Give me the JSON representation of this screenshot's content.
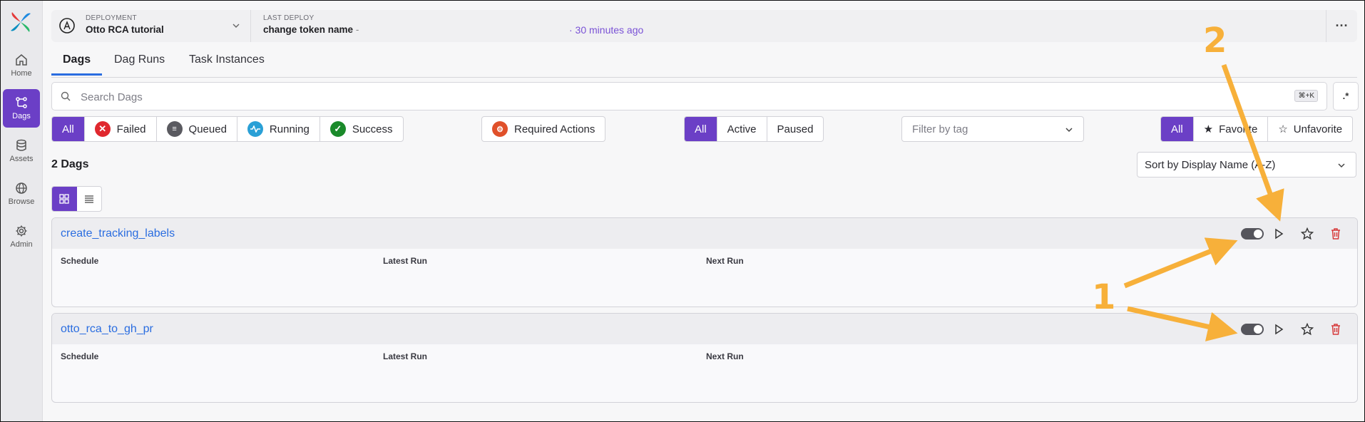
{
  "sidebar": {
    "items": [
      {
        "label": "Home",
        "icon": "home-icon"
      },
      {
        "label": "Dags",
        "icon": "dag-icon",
        "active": true
      },
      {
        "label": "Assets",
        "icon": "database-icon"
      },
      {
        "label": "Browse",
        "icon": "globe-icon"
      },
      {
        "label": "Admin",
        "icon": "gear-icon"
      }
    ]
  },
  "header": {
    "deployment_label": "DEPLOYMENT",
    "deployment_name": "Otto RCA tutorial",
    "last_deploy_label": "LAST DEPLOY",
    "last_deploy_name": "change token name",
    "last_deploy_sep": "-",
    "last_deploy_ago": "· 30 minutes ago",
    "more_label": "···"
  },
  "tabs": [
    {
      "label": "Dags",
      "active": true
    },
    {
      "label": "Dag Runs"
    },
    {
      "label": "Task Instances"
    }
  ],
  "search": {
    "placeholder": "Search Dags",
    "shortcut": "⌘+K",
    "advanced_label": ".*"
  },
  "state_filters": {
    "all": "All",
    "failed": "Failed",
    "queued": "Queued",
    "running": "Running",
    "success": "Success"
  },
  "required_actions": "Required Actions",
  "active_filters": {
    "all": "All",
    "active": "Active",
    "paused": "Paused"
  },
  "tag_filter": {
    "placeholder": "Filter by tag"
  },
  "favorite_filters": {
    "all": "All",
    "favorite": "Favorite",
    "unfavorite": "Unfavorite"
  },
  "dag_count": "2 Dags",
  "sort": {
    "selected": "Sort by Display Name (A-Z)"
  },
  "dags": [
    {
      "name": "create_tracking_labels",
      "schedule": "Schedule",
      "latest_run": "Latest Run",
      "next_run": "Next Run",
      "paused": false
    },
    {
      "name": "otto_rca_to_gh_pr",
      "schedule": "Schedule",
      "latest_run": "Latest Run",
      "next_run": "Next Run",
      "paused": false
    }
  ],
  "annotations": {
    "one": "1",
    "two": "2"
  },
  "colors": {
    "accent": "#6b3fc6",
    "link": "#2a6de0",
    "failed": "#e0282e",
    "queued": "#5a5a60",
    "running": "#2aa0d6",
    "success": "#1a8a2a",
    "required": "#e0502a",
    "delete": "#d63a3a",
    "annotation": "#f7b03a"
  }
}
